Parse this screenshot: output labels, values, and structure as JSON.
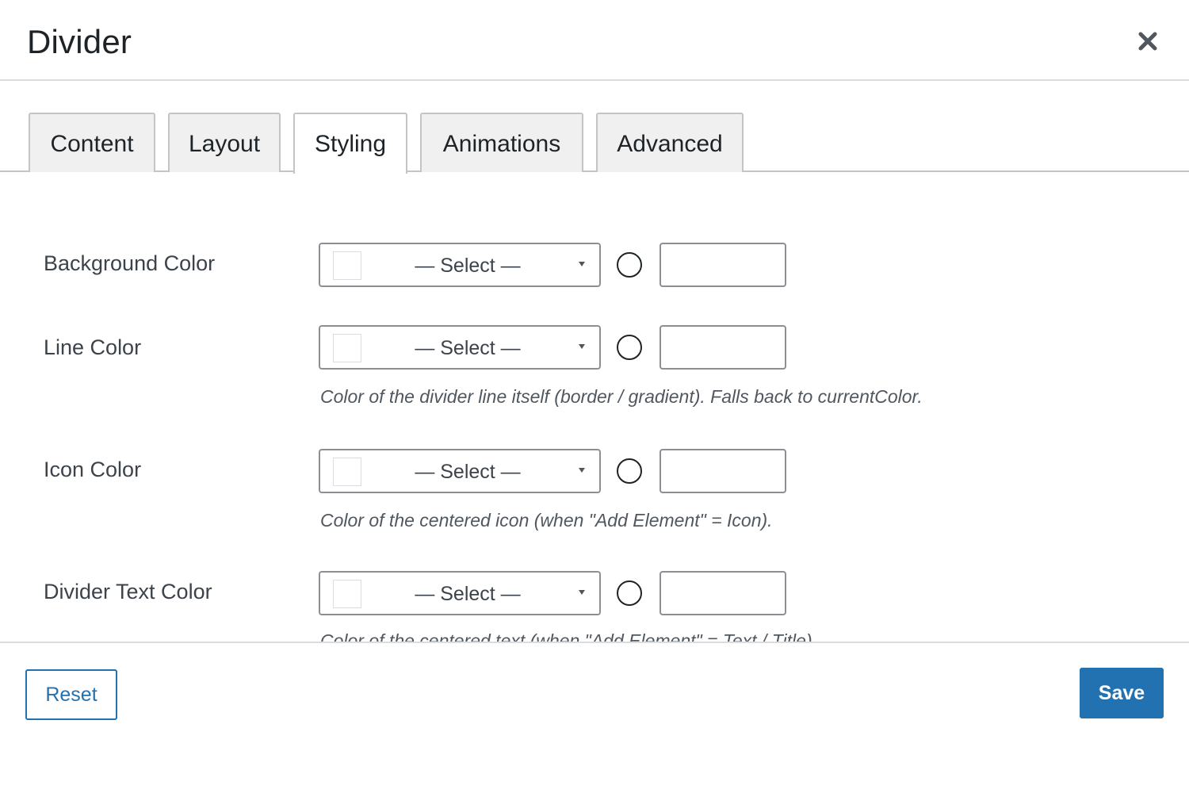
{
  "dialog": {
    "title": "Divider",
    "close_icon": "close-icon"
  },
  "tabs": [
    {
      "label": "Content",
      "active": false
    },
    {
      "label": "Layout",
      "active": false
    },
    {
      "label": "Styling",
      "active": true
    },
    {
      "label": "Animations",
      "active": false
    },
    {
      "label": "Advanced",
      "active": false
    }
  ],
  "fields": [
    {
      "label": "Background Color",
      "select_value": "— Select —",
      "input_value": "",
      "help": ""
    },
    {
      "label": "Line Color",
      "select_value": "— Select —",
      "input_value": "",
      "help": "Color of the divider line itself (border / gradient). Falls back to currentColor."
    },
    {
      "label": "Icon Color",
      "select_value": "— Select —",
      "input_value": "",
      "help": "Color of the centered icon (when \"Add Element\" = Icon)."
    },
    {
      "label": "Divider Text Color",
      "select_value": "— Select —",
      "input_value": "",
      "help": "Color of the centered text (when \"Add Element\" = Text / Title)."
    }
  ],
  "footer": {
    "reset_label": "Reset",
    "save_label": "Save"
  },
  "colors": {
    "accent": "#2271b1",
    "text": "#1d2327",
    "muted_text": "#50575e",
    "border": "#8c8f94",
    "tab_inactive_bg": "#f0f0f1"
  }
}
